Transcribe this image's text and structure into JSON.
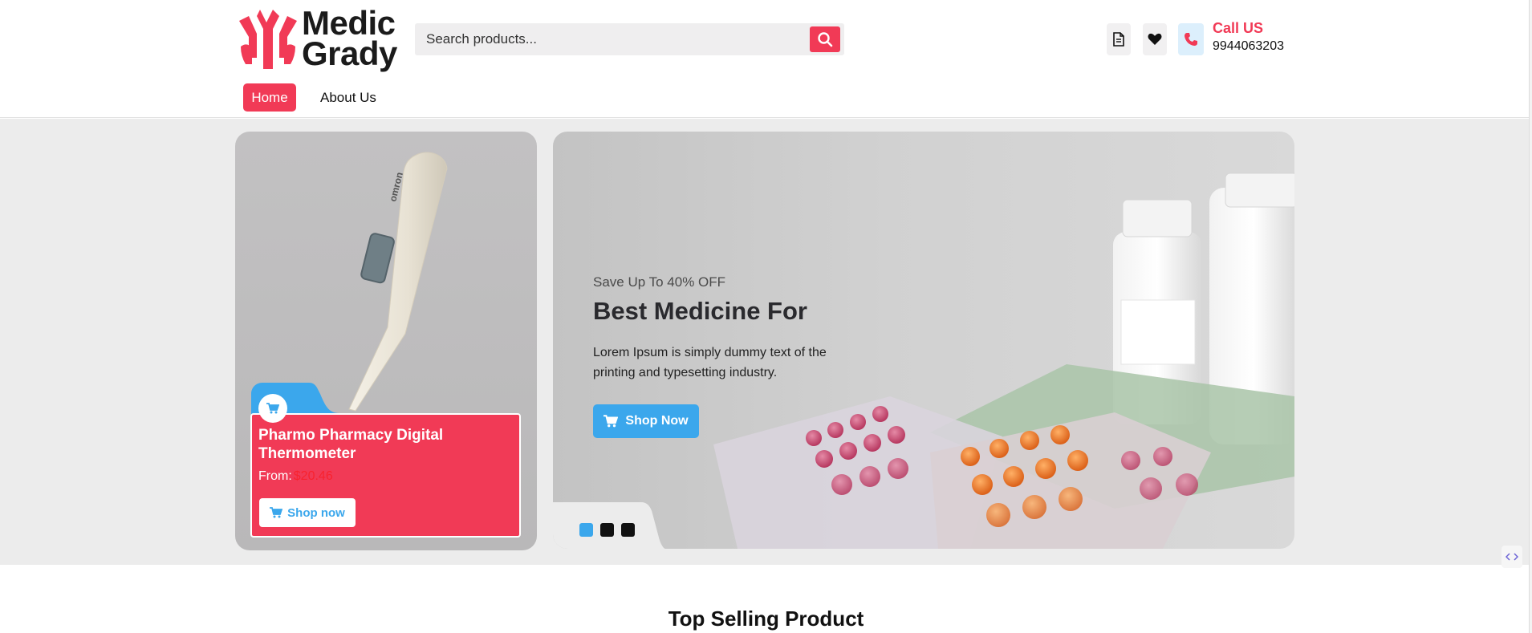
{
  "brand": {
    "line1": "Medic",
    "line2": "Grady"
  },
  "search": {
    "placeholder": "Search products..."
  },
  "header": {
    "call_title": "Call US",
    "call_number": "9944063203"
  },
  "nav": {
    "home": "Home",
    "about": "About Us"
  },
  "promo": {
    "title": "Pharmo Pharmacy Digital Thermometer",
    "from_label": "From:",
    "price": "$20.46",
    "button": "Shop now"
  },
  "slider": {
    "eyebrow": "Save Up To 40% OFF",
    "heading": "Best Medicine For",
    "body": "Lorem Ipsum is simply dummy text of the printing and typesetting industry.",
    "button": "Shop Now",
    "active_slide": 1,
    "slide_count": 3
  },
  "sections": {
    "top_selling": "Top Selling Product"
  },
  "colors": {
    "primary": "#f13a56",
    "accent": "#3ba7ec",
    "hero_bg": "#ececec"
  },
  "icons": [
    "search-icon",
    "document-icon",
    "heart-icon",
    "phone-icon",
    "cart-icon"
  ]
}
